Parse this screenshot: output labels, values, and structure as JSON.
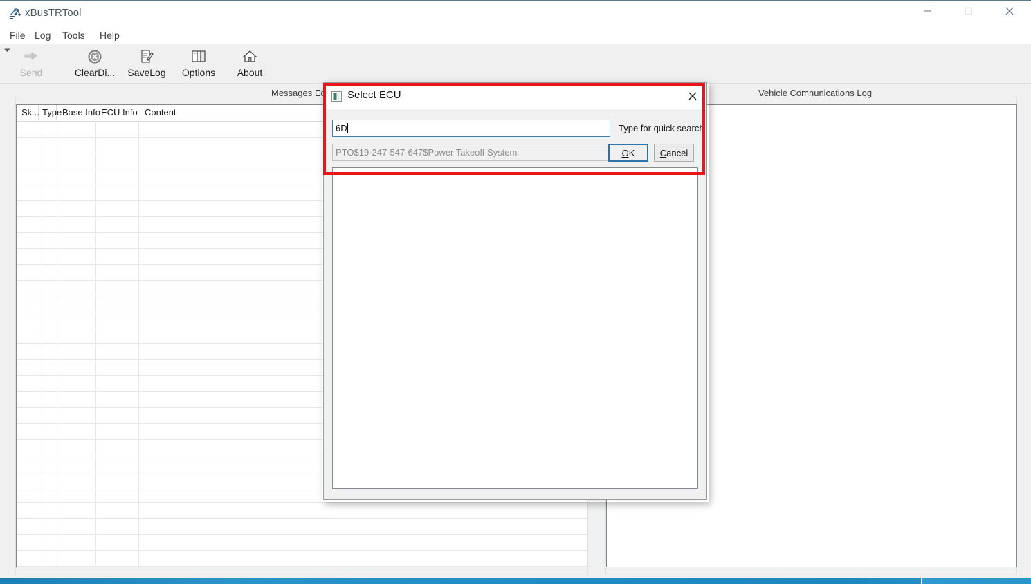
{
  "app": {
    "title": "xBusTRTool",
    "icon": "app-network-icon",
    "window_controls": {
      "minimize": "minimize-icon",
      "maximize": "maximize-icon",
      "close": "close-icon"
    }
  },
  "menu": {
    "items": [
      {
        "label": "File"
      },
      {
        "label": "Log"
      },
      {
        "label": "Tools"
      },
      {
        "label": "Help"
      }
    ]
  },
  "toolbar": {
    "buttons": [
      {
        "label": "Send",
        "icon": "send-arrow-icon",
        "enabled": false
      },
      {
        "label": "ClearDi...",
        "icon": "clear-circle-x-icon",
        "enabled": true
      },
      {
        "label": "SaveLog",
        "icon": "save-log-icon",
        "enabled": true
      },
      {
        "label": "Options",
        "icon": "options-panels-icon",
        "enabled": true
      },
      {
        "label": "About",
        "icon": "about-home-icon",
        "enabled": true
      }
    ],
    "dropdown_icon": "chevron-down-icon"
  },
  "panels": {
    "messages_editor": {
      "caption": "Messages Editor",
      "columns": [
        "Sk...",
        "Type",
        "Base Info",
        "ECU Info",
        "Content"
      ],
      "rows": []
    },
    "vehicle_log": {
      "caption": "Vehicle Comnunications Log",
      "content": ""
    }
  },
  "dialog": {
    "title": "Select ECU",
    "icon": "dialog-window-icon",
    "close_icon": "close-icon",
    "search": {
      "value": "6D",
      "hint": "Type for quick search"
    },
    "result": {
      "value": "PTO$19-247-547-647$Power Takeoff System"
    },
    "buttons": {
      "ok": {
        "prefix": "O",
        "suffix": "K"
      },
      "cancel": {
        "prefix": "C",
        "suffix": "ancel"
      }
    },
    "list": {
      "items": []
    }
  },
  "annotation": {
    "highlight_color": "#e8161a"
  }
}
